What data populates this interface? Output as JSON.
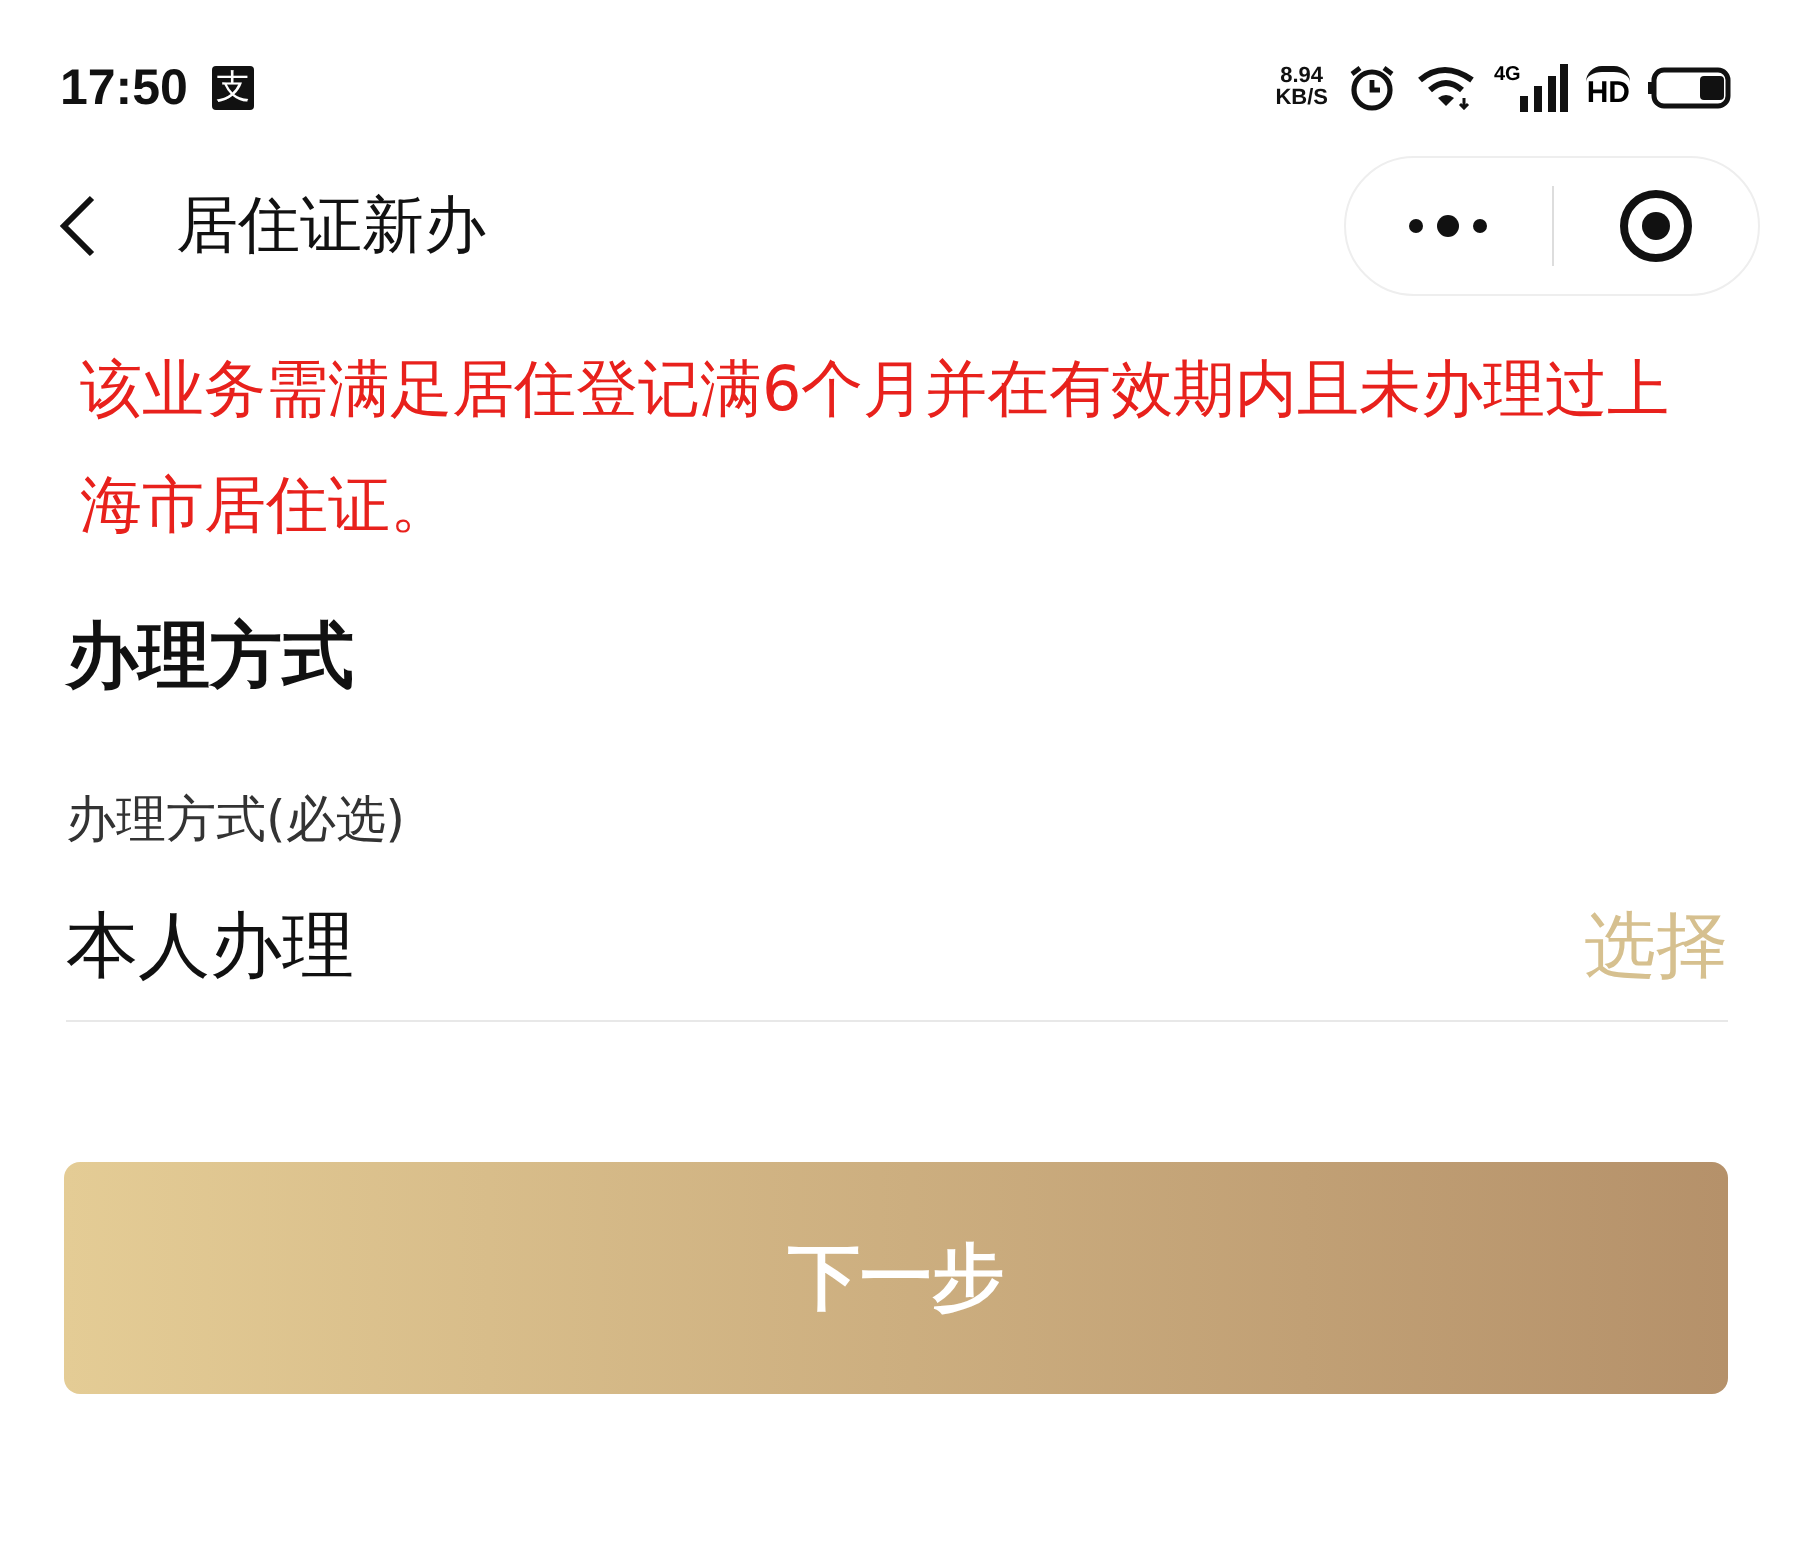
{
  "status_bar": {
    "time": "17:50",
    "app_badge": "支",
    "speed_value": "8.94",
    "speed_unit": "KB/S",
    "network": "4G",
    "hd": "HD"
  },
  "nav": {
    "title": "居住证新办"
  },
  "notice": "该业务需满足居住登记满6个月并在有效期内且未办理过上海市居住证。",
  "section": {
    "title": "办理方式"
  },
  "field": {
    "label": "办理方式(必选)",
    "value": "本人办理",
    "action": "选择"
  },
  "next_button": "下一步"
}
